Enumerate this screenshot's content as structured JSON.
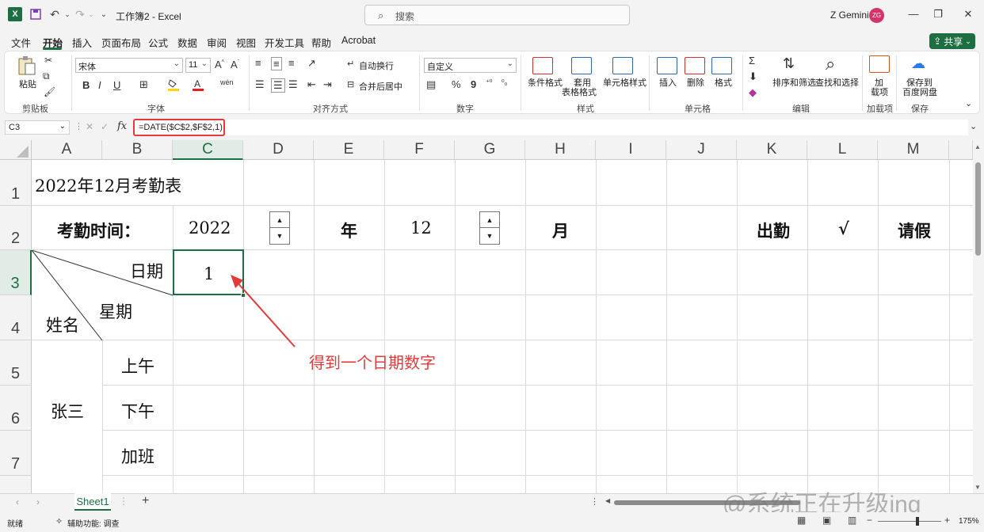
{
  "titlebar": {
    "doc_title": "工作簿2 - Excel",
    "search_placeholder": "搜索",
    "user_name": "Z Gemini",
    "avatar_initials": "ZG"
  },
  "menu": {
    "tabs": [
      "文件",
      "开始",
      "插入",
      "页面布局",
      "公式",
      "数据",
      "审阅",
      "视图",
      "开发工具",
      "帮助",
      "Acrobat"
    ],
    "active": "开始",
    "share_label": "共享"
  },
  "ribbon": {
    "clipboard": {
      "paste": "粘贴",
      "group": "剪贴板"
    },
    "font": {
      "name": "宋体",
      "size": "11",
      "group": "字体",
      "bold": "B",
      "italic": "I",
      "underline": "U"
    },
    "alignment": {
      "wrap": "自动换行",
      "merge": "合并后居中",
      "group": "对齐方式"
    },
    "number": {
      "format": "自定义",
      "percent": "%",
      "comma": "9",
      "group": "数字"
    },
    "styles": {
      "cond": "条件格式",
      "table1": "套用",
      "table2": "表格格式",
      "cell": "单元格样式",
      "group": "样式"
    },
    "cells": {
      "insert": "插入",
      "delete": "删除",
      "format": "格式",
      "group": "单元格"
    },
    "editing": {
      "sort": "排序和筛选",
      "find": "查找和选择",
      "group": "编辑"
    },
    "addins": {
      "label1": "加",
      "label2": "载项",
      "group": "加载项"
    },
    "save": {
      "label1": "保存到",
      "label2": "百度网盘",
      "group": "保存"
    }
  },
  "formula_bar": {
    "name_box": "C3",
    "formula": "=DATE($C$2,$F$2,1)"
  },
  "grid": {
    "columns": [
      "A",
      "B",
      "C",
      "D",
      "E",
      "F",
      "G",
      "H",
      "I",
      "J",
      "K",
      "L",
      "M"
    ],
    "rows": [
      "1",
      "2",
      "3",
      "4",
      "5",
      "6",
      "7"
    ],
    "selected_col": "C",
    "selected_row": "3",
    "cells": {
      "a1": "2022年12月考勤表",
      "a2": "考勤时间：",
      "c2": "2022",
      "e2": "年",
      "f2": "12",
      "h2": "月",
      "k2": "出勤",
      "l2": "√",
      "m2": "请假",
      "b3_date": "日期",
      "b4_week": "星期",
      "a4_name": "姓名",
      "c3": "1",
      "a6": "张三",
      "b5": "上午",
      "b6": "下午",
      "b7": "加班"
    }
  },
  "annotation": {
    "text": "得到一个日期数字",
    "color": "#e23b3b"
  },
  "sheet_tabs": [
    "Sheet1"
  ],
  "watermark": "@系统正在升级ing",
  "status": {
    "ready": "就绪",
    "accessibility": "辅助功能: 调查",
    "zoom": "175%"
  },
  "colors": {
    "accent": "#1d6f42",
    "annotation": "#e23b3b"
  }
}
